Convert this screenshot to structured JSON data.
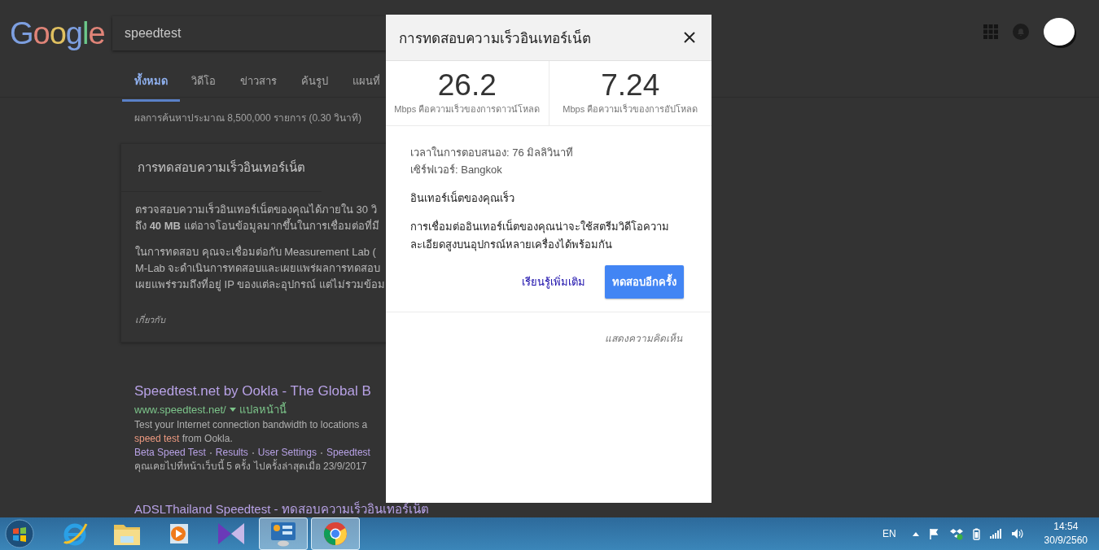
{
  "search_page": {
    "logo": "Google",
    "query": "speedtest",
    "tabs": [
      {
        "label": "ทั้งหมด",
        "selected": true
      },
      {
        "label": "วิดีโอ",
        "selected": false
      },
      {
        "label": "ข่าวสาร",
        "selected": false
      },
      {
        "label": "ค้นรูป",
        "selected": false
      },
      {
        "label": "แผนที่",
        "selected": false
      }
    ],
    "result_stats": "ผลการค้นหาประมาณ 8,500,000 รายการ (0.30 วินาที)",
    "card": {
      "title": "การทดสอบความเร็วอินเทอร์เน็ต",
      "paragraphs": [
        [
          "ตรวจสอบความเร็วอินเทอร์เน็ตของคุณได้ภายใน 30 วิ",
          "ถึง **40 MB** แต่อาจโอนข้อมูลมากขึ้นในการเชื่อมต่อที่มี"
        ],
        [
          "ในการทดสอบ คุณจะเชื่อมต่อกับ Measurement Lab (",
          "M-Lab จะดำเนินการทดสอบและเผยแพร่ผลการทดสอบ",
          "เผยแพร่รวมถึงที่อยู่ IP ของแต่ละอุปกรณ์ แต่ไม่รวมข้อม"
        ]
      ],
      "about": "เกี่ยวกับ"
    },
    "results": [
      {
        "title": "Speedtest.net by Ookla - The Global B",
        "url": "www.speedtest.net/",
        "translate": "แปลหน้านี้",
        "snippet": [
          [
            {
              "text": "Test your Internet connection bandwidth to locations a",
              "highlight": false
            }
          ],
          [
            {
              "text": "speed test",
              "highlight": true
            },
            {
              "text": " from Ookla.",
              "highlight": false
            }
          ]
        ],
        "sitelinks": [
          "Beta Speed Test",
          "Results",
          "User Settings",
          "Speedtest"
        ],
        "visited": "คุณเคยไปที่หน้าเว็บนี้ 5 ครั้ง ไปครั้งล่าสุดเมื่อ 23/9/2017"
      },
      {
        "title": "ADSLThailand Speedtest - ทดสอบความเร็วอินเทอร์เน็ต"
      }
    ]
  },
  "dialog": {
    "title": "การทดสอบความเร็วอินเทอร์เน็ต",
    "speeds": [
      {
        "value": "26.2",
        "caption": "Mbps คือความเร็วของการดาวน์โหลด"
      },
      {
        "value": "7.24",
        "caption": "Mbps คือความเร็วของการอัปโหลด"
      }
    ],
    "latency": "เวลาในการตอบสนอง: 76 มิลลิวินาที",
    "server": "เซิร์ฟเวอร์: Bangkok",
    "verdict": "อินเทอร์เน็ตของคุณเร็ว",
    "description": [
      "การเชื่อมต่ออินเทอร์เน็ตของคุณน่าจะใช้สตรีมวิดีโอความ",
      "ละเอียดสูงบนอุปกรณ์หลายเครื่องได้พร้อมกัน"
    ],
    "learn_more": "เรียนรู้เพิ่มเติม",
    "retest": "ทดสอบอีกครั้ง",
    "feedback": "แสดงความคิดเห็น"
  },
  "taskbar": {
    "apps": [
      {
        "kind": "start",
        "selected": false
      },
      {
        "kind": "ie",
        "selected": false
      },
      {
        "kind": "folder",
        "selected": false
      },
      {
        "kind": "media",
        "selected": false
      },
      {
        "kind": "vs",
        "selected": false
      },
      {
        "kind": "control",
        "selected": true
      },
      {
        "kind": "chrome",
        "selected": true
      }
    ],
    "language": "EN",
    "time": "14:54",
    "date": "30/9/2560"
  }
}
